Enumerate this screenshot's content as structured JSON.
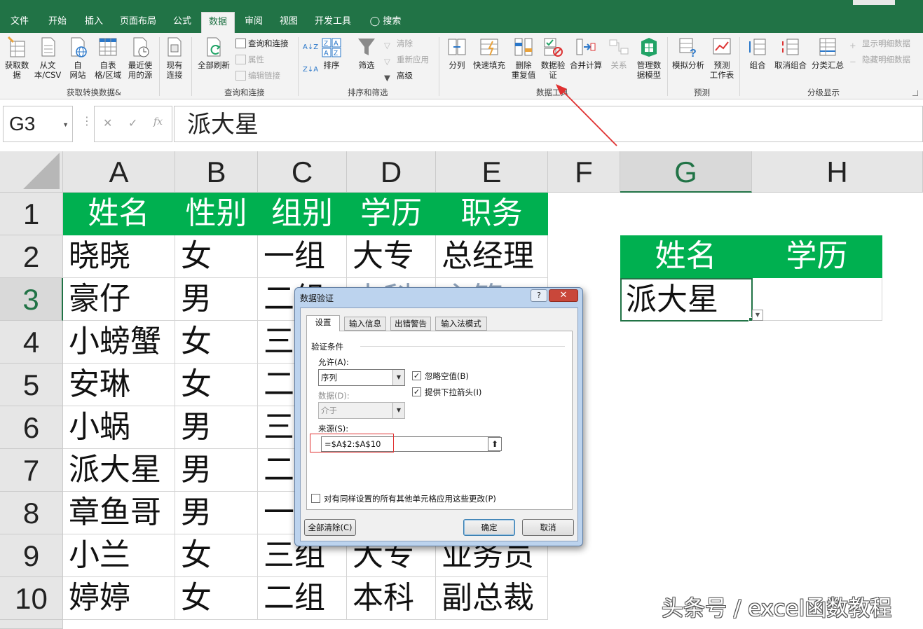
{
  "ribbon_tabs": [
    "文件",
    "开始",
    "插入",
    "页面布局",
    "公式",
    "数据",
    "审阅",
    "视图",
    "开发工具",
    "搜索"
  ],
  "groups": {
    "get": {
      "label": "获取转换数据&",
      "buttons": [
        "获取数\n据",
        "从文\n本/CSV",
        "自\n网站",
        "自表\n格/区域",
        "最近使\n用的源",
        "现有\n连接"
      ]
    },
    "query": {
      "label": "查询和连接",
      "refresh": "全部刷新",
      "items": [
        "查询和连接",
        "属性",
        "编辑链接"
      ]
    },
    "sort": {
      "label": "排序和筛选",
      "sort": "排序",
      "filter": "筛选",
      "items": [
        "清除",
        "重新应用",
        "高级"
      ]
    },
    "tools": {
      "label": "数据工具",
      "buttons": [
        "分列",
        "快速填充",
        "删除\n重复值",
        "数据验\n证",
        "合并计算",
        "关系",
        "管理数\n据模型"
      ]
    },
    "forecast": {
      "label": "预测",
      "buttons": [
        "模拟分析",
        "预测\n工作表"
      ]
    },
    "outline": {
      "label": "分级显示",
      "buttons": [
        "组合",
        "取消组合",
        "分类汇总"
      ],
      "items": [
        "显示明细数据",
        "隐藏明细数据"
      ]
    }
  },
  "formula_bar": {
    "name_box": "G3",
    "cancel": "✕",
    "enter": "✓",
    "fx": "fx",
    "content": "派大星"
  },
  "sheet": {
    "columns": [
      "A",
      "B",
      "C",
      "D",
      "E",
      "F",
      "G",
      "H"
    ],
    "rows": [
      "1",
      "2",
      "3",
      "4",
      "5",
      "6",
      "7",
      "8",
      "9",
      "10"
    ],
    "header": [
      "姓名",
      "性别",
      "组别",
      "学历",
      "职务"
    ],
    "data": [
      [
        "晓晓",
        "女",
        "一组",
        "大专",
        "总经理"
      ],
      [
        "豪仔",
        "男",
        "二组",
        "本科",
        "主管"
      ],
      [
        "小螃蟹",
        "女",
        "三组",
        "",
        ""
      ],
      [
        "安琳",
        "女",
        "二组",
        "",
        ""
      ],
      [
        "小蜗",
        "男",
        "三组",
        "",
        ""
      ],
      [
        "派大星",
        "男",
        "二组",
        "",
        ""
      ],
      [
        "章鱼哥",
        "男",
        "一组",
        "",
        ""
      ],
      [
        "小兰",
        "女",
        "三组",
        "大专",
        "业务员"
      ],
      [
        "婷婷",
        "女",
        "二组",
        "本科",
        "副总裁"
      ]
    ],
    "lookup_header": [
      "姓名",
      "学历"
    ],
    "lookup_value": "派大星"
  },
  "dialog": {
    "title": "数据验证",
    "help": "?",
    "close": "✕",
    "tabs": [
      "设置",
      "输入信息",
      "出错警告",
      "输入法模式"
    ],
    "section": "验证条件",
    "allow_label": "允许(A):",
    "allow_value": "序列",
    "data_label": "数据(D):",
    "data_value": "介于",
    "ignore_blank": "忽略空值(B)",
    "dropdown": "提供下拉箭头(I)",
    "source_label": "来源(S):",
    "source_value": "=$A$2:$A$10",
    "apply_all": "对有同样设置的所有其他单元格应用这些更改(P)",
    "clear_all": "全部清除(C)",
    "ok": "确定",
    "cancel": "取消"
  },
  "watermark": "头条号 / excel函数教程",
  "colors": {
    "excel_green": "#217346",
    "header_fill": "#00b050",
    "arrow_red": "#e03030"
  }
}
